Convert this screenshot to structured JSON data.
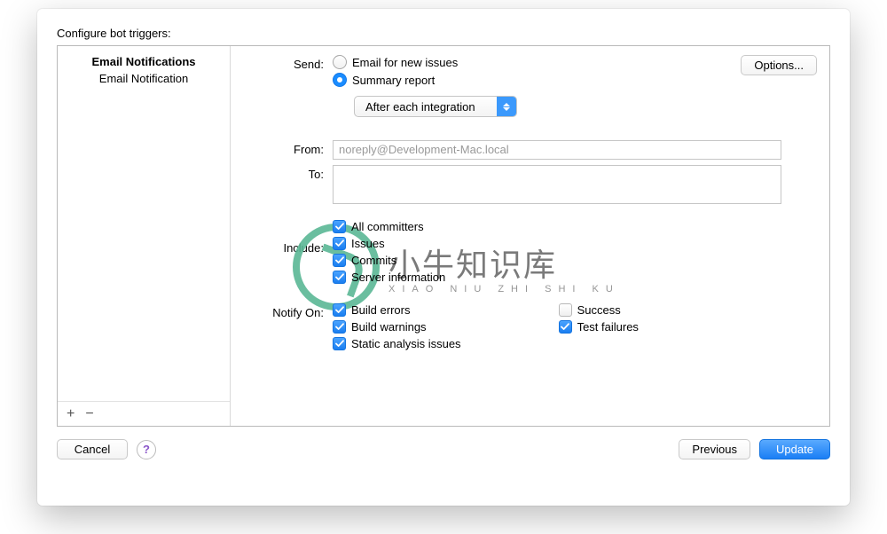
{
  "title": "Configure bot triggers:",
  "sidebar": {
    "header": "Email Notifications",
    "item": "Email Notification"
  },
  "options_button": "Options...",
  "labels": {
    "send": "Send:",
    "from": "From:",
    "to": "To:",
    "include": "Include:",
    "notify": "Notify On:"
  },
  "send": {
    "email_new_issues": "Email for new issues",
    "summary_report": "Summary report",
    "frequency": "After each integration"
  },
  "from_value": "noreply@Development-Mac.local",
  "to_value": "",
  "include": {
    "all_committers": "All committers",
    "issues": "Issues",
    "commits": "Commits",
    "server_info": "Server information"
  },
  "notify": {
    "build_errors": "Build errors",
    "build_warnings": "Build warnings",
    "static_analysis": "Static analysis issues",
    "success": "Success",
    "test_failures": "Test failures"
  },
  "footer": {
    "cancel": "Cancel",
    "previous": "Previous",
    "update": "Update"
  },
  "icons": {
    "add": "+",
    "remove": "−",
    "help": "?"
  },
  "watermark": {
    "big": "小牛知识库",
    "small": "XIAO NIU ZHI SHI KU"
  }
}
